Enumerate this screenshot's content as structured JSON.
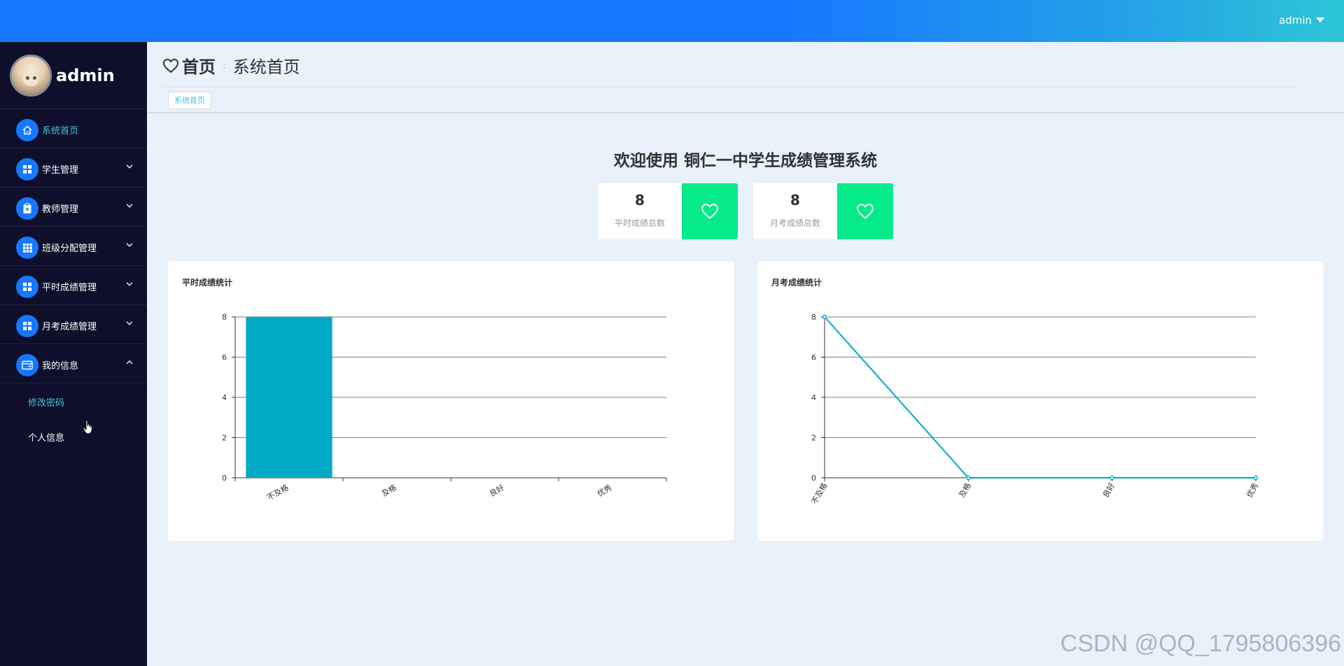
{
  "header": {
    "user": "admin"
  },
  "sidebar": {
    "username": "admin",
    "items": [
      {
        "label": "系统首页",
        "icon": "home-icon",
        "active": true
      },
      {
        "label": "学生管理",
        "icon": "grid-icon"
      },
      {
        "label": "教师管理",
        "icon": "clipboard-icon"
      },
      {
        "label": "班级分配管理",
        "icon": "table-icon"
      },
      {
        "label": "平时成绩管理",
        "icon": "grid-icon"
      },
      {
        "label": "月考成绩管理",
        "icon": "grid-icon"
      },
      {
        "label": "我的信息",
        "icon": "wallet-icon",
        "expanded": true
      }
    ],
    "subitems": [
      {
        "label": "修改密码",
        "active": true
      },
      {
        "label": "个人信息"
      }
    ]
  },
  "breadcrumb": {
    "home": "首页",
    "separator": ":",
    "page": "系统首页"
  },
  "tags": [
    "系统首页"
  ],
  "welcome": "欢迎使用 铜仁一中学生成绩管理系统",
  "stats": [
    {
      "value": "8",
      "label": "平时成绩总数",
      "icon": "heart-icon"
    },
    {
      "value": "8",
      "label": "月考成绩总数",
      "icon": "heart-icon"
    }
  ],
  "colors": {
    "primary": "#1677ff",
    "accent": "#07ea8a",
    "series": "#00a9c4",
    "sidebar": "#0f0f2b",
    "active_text": "#45c3d8"
  },
  "chart_data": [
    {
      "type": "bar",
      "title": "平时成绩统计",
      "categories": [
        "不及格",
        "及格",
        "良好",
        "优秀"
      ],
      "values": [
        8,
        0,
        0,
        0
      ],
      "ylim": [
        0,
        8
      ],
      "yticks": [
        0,
        2,
        4,
        6,
        8
      ],
      "grid": true
    },
    {
      "type": "line",
      "title": "月考成绩统计",
      "categories": [
        "不及格",
        "及格",
        "良好",
        "优秀"
      ],
      "values": [
        8,
        0,
        0,
        0
      ],
      "ylim": [
        0,
        8
      ],
      "yticks": [
        0,
        2,
        4,
        6,
        8
      ],
      "grid": true
    }
  ],
  "watermark": "CSDN @QQ_1795806396"
}
